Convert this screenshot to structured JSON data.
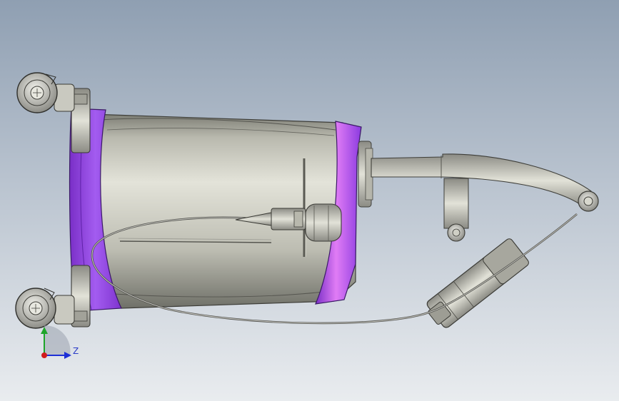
{
  "viewport": {
    "background_top": "#8f9fb2",
    "background_bottom": "#e9ecef"
  },
  "model": {
    "body_color": "#c6c6bc",
    "band_color": "#9b45e6",
    "band_highlight": "#e07cf5",
    "wire_color": "#5c5c5c"
  },
  "triad": {
    "z_label": "Z",
    "x_axis_color": "#1d2fd6",
    "y_axis_color": "#1ea52a",
    "origin_color": "#d11c1c"
  }
}
